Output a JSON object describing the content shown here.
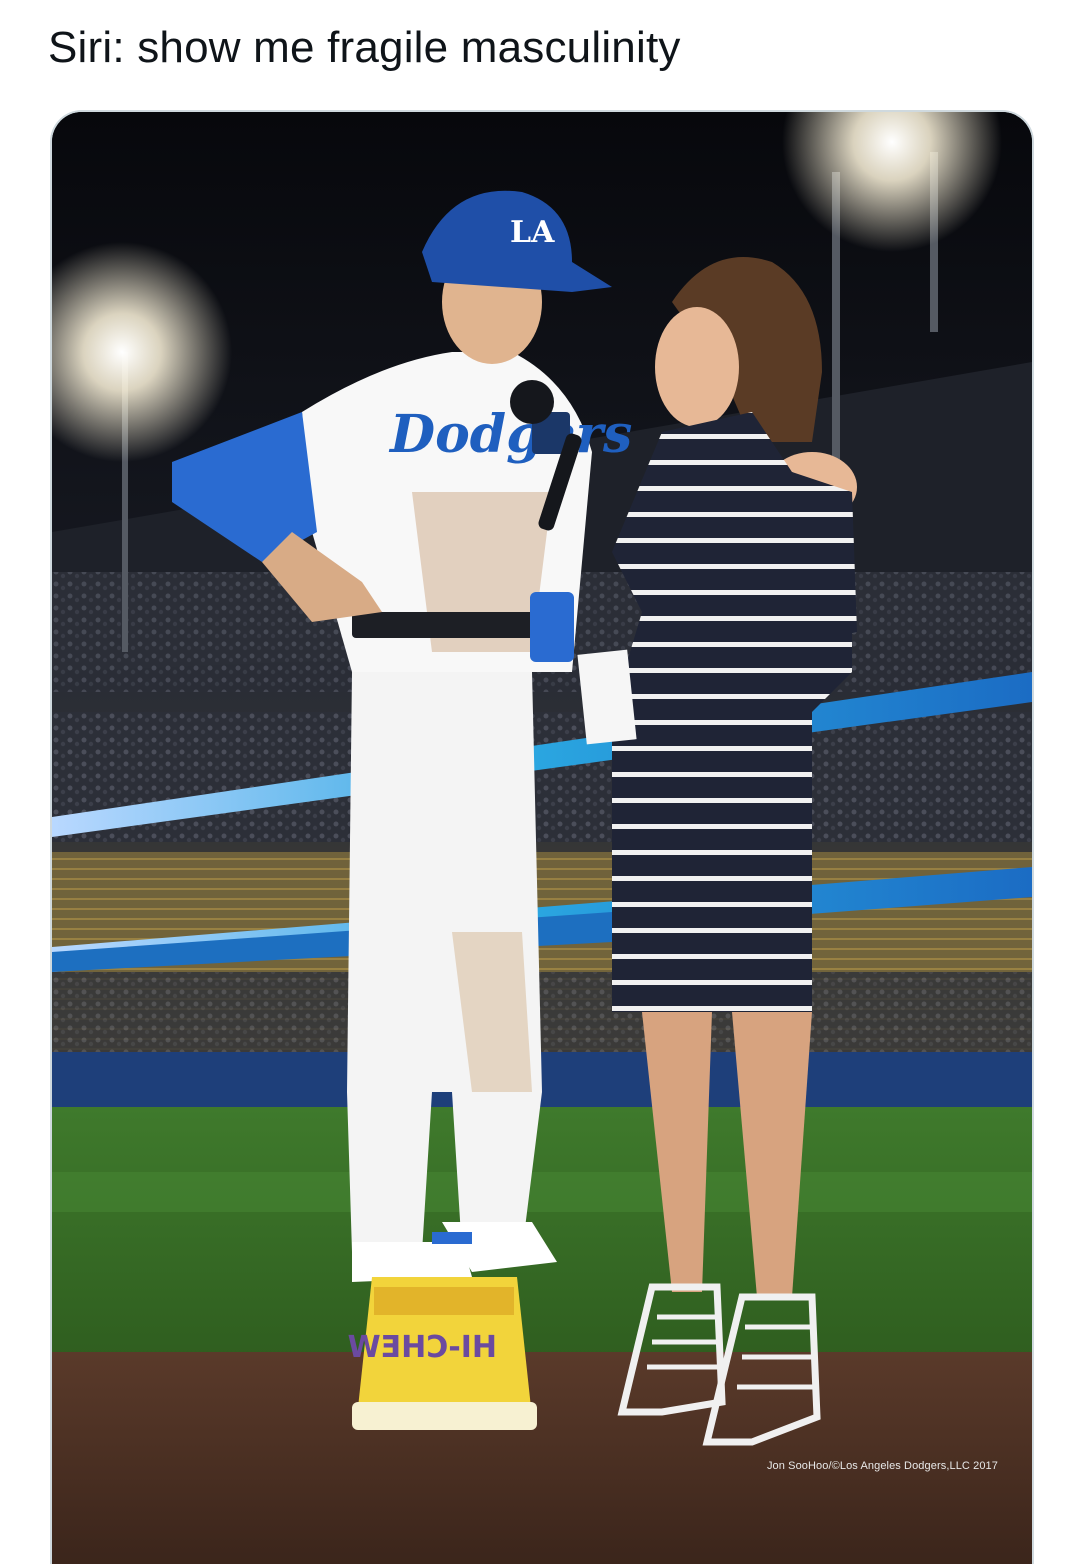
{
  "post": {
    "text": "Siri: show me fragile masculinity"
  },
  "media": {
    "jersey_text": "Dodgers",
    "bucket_brand": "HI-CHEW",
    "credit": "Jon SooHoo/©Los Angeles Dodgers,LLC 2017"
  },
  "colors": {
    "text": "#0f1419",
    "media_border": "#cfd9de",
    "dodger_blue": "#1f5fbf",
    "grass": "#3f7a2c",
    "dirt": "#4a3124",
    "bucket_yellow": "#f2d43b"
  }
}
